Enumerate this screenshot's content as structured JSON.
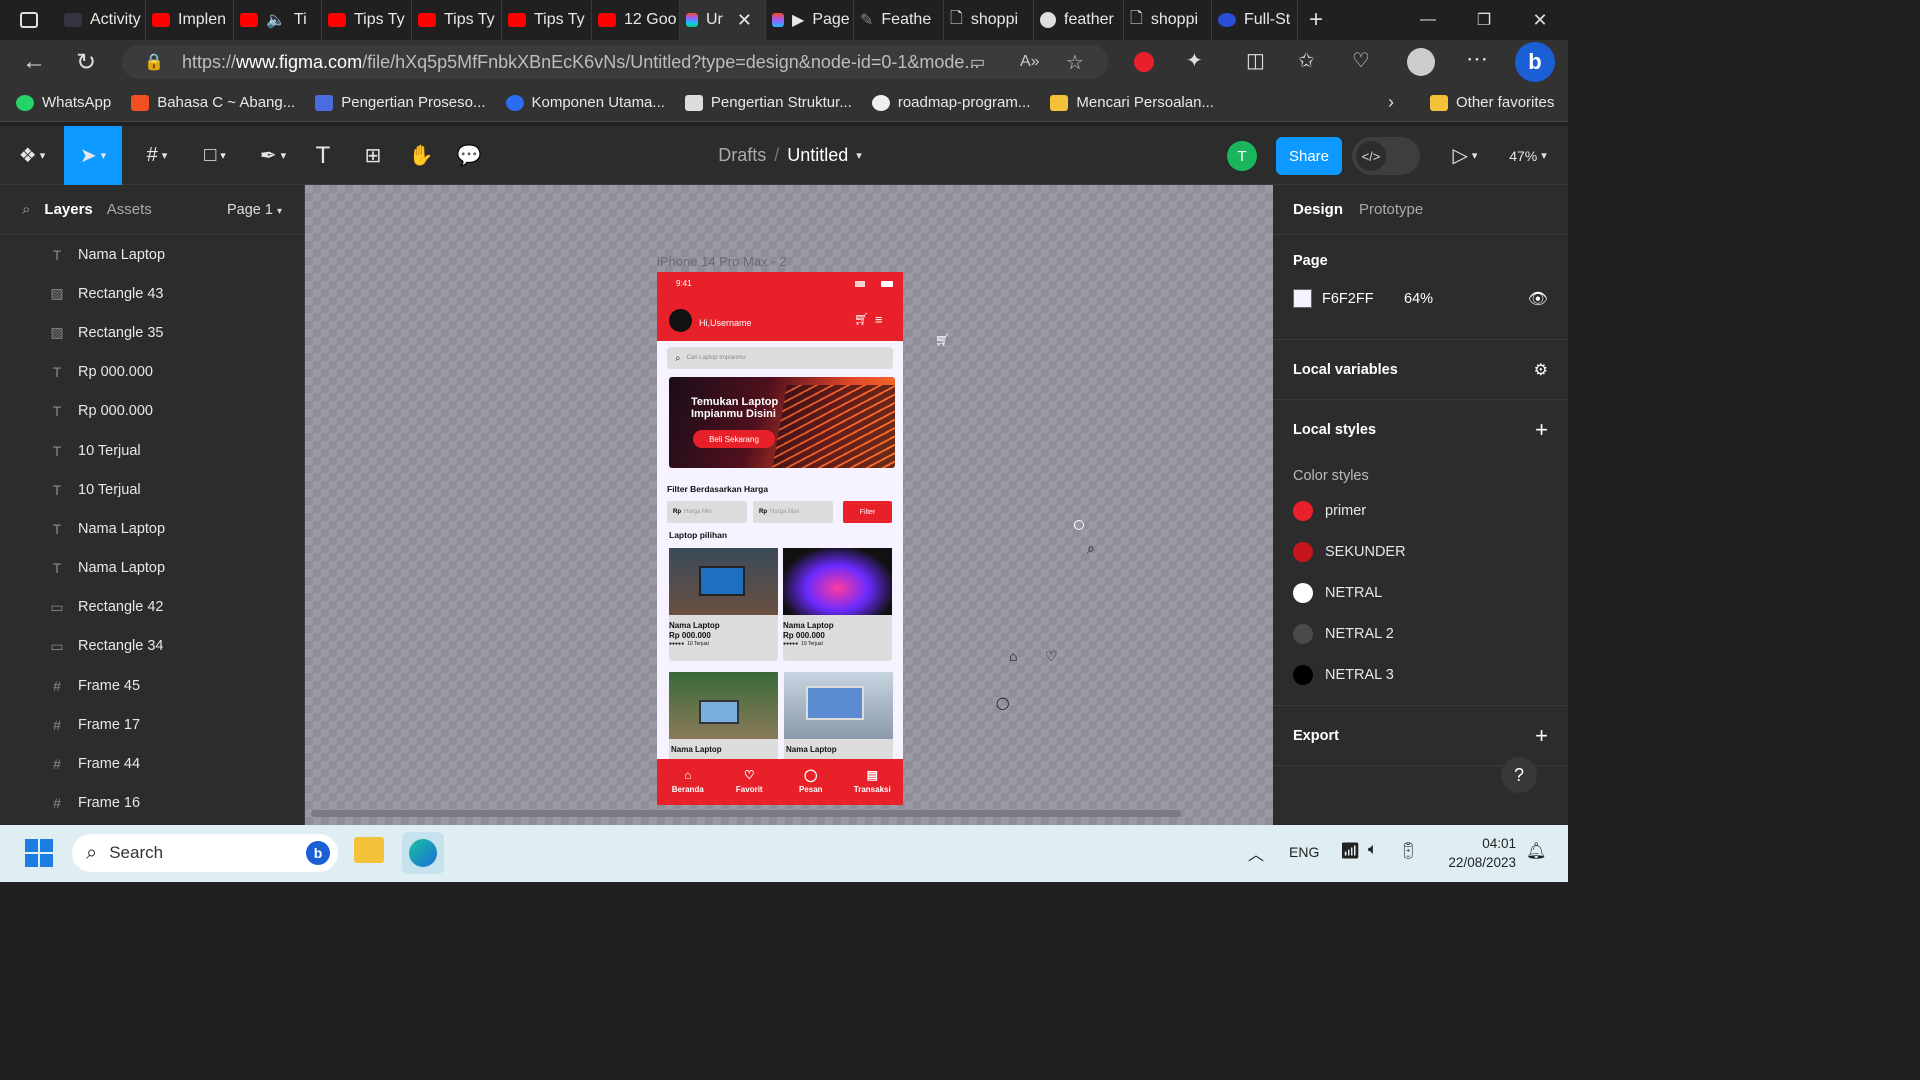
{
  "browser": {
    "tabs": [
      "Activity",
      "Implen",
      "Ti",
      "Tips Ty",
      "Tips Ty",
      "Tips Ty",
      "12 Goo",
      "Ur",
      "Page",
      "Feathe",
      "shoppi",
      "feather",
      "shoppi",
      "Full-St"
    ],
    "url_prefix": "https://",
    "url_domain": "www.figma.com",
    "url_rest": "/file/hXq5p5MfFnbkXBnEcK6vNs/Untitled?type=design&node-id=0-1&mode...",
    "bookmarks": [
      "WhatsApp",
      "Bahasa C ~ Abang...",
      "Pengertian Proseso...",
      "Komponen Utama...",
      "Pengertian Struktur...",
      "roadmap-program...",
      "Mencari Persoalan..."
    ],
    "other_favorites": "Other favorites"
  },
  "figma": {
    "breadcrumb_drafts": "Drafts",
    "breadcrumb_sep": "/",
    "file_name": "Untitled",
    "avatar_initial": "T",
    "share_label": "Share",
    "zoom": "47%",
    "left_tabs": {
      "layers": "Layers",
      "assets": "Assets",
      "page": "Page 1"
    },
    "layers": [
      {
        "name": "Nama Laptop",
        "icon": "text-icon"
      },
      {
        "name": "Rectangle 43",
        "icon": "image-icon"
      },
      {
        "name": "Rectangle 35",
        "icon": "image-icon"
      },
      {
        "name": "Rp 000.000",
        "icon": "text-icon"
      },
      {
        "name": "Rp 000.000",
        "icon": "text-icon"
      },
      {
        "name": "10 Terjual",
        "icon": "text-icon"
      },
      {
        "name": "10 Terjual",
        "icon": "text-icon"
      },
      {
        "name": "Nama Laptop",
        "icon": "text-icon"
      },
      {
        "name": "Nama Laptop",
        "icon": "text-icon"
      },
      {
        "name": "Rectangle 42",
        "icon": "rect-icon"
      },
      {
        "name": "Rectangle 34",
        "icon": "rect-icon"
      },
      {
        "name": "Frame 45",
        "icon": "frame-icon"
      },
      {
        "name": "Frame 17",
        "icon": "frame-icon"
      },
      {
        "name": "Frame 44",
        "icon": "frame-icon"
      },
      {
        "name": "Frame 16",
        "icon": "frame-icon"
      }
    ],
    "right_tabs": {
      "design": "Design",
      "prototype": "Prototype"
    },
    "page_section": "Page",
    "page_color": "F6F2FF",
    "page_opacity": "64%",
    "local_variables": "Local variables",
    "local_styles": "Local styles",
    "color_styles_title": "Color styles",
    "color_styles": [
      {
        "name": "primer",
        "color": "#e8202a"
      },
      {
        "name": "SEKUNDER",
        "color": "#c4161c"
      },
      {
        "name": "NETRAL",
        "color": "#ffffff"
      },
      {
        "name": "NETRAL 2",
        "color": "#4a4a4a"
      },
      {
        "name": "NETRAL 3",
        "color": "#000000"
      }
    ],
    "export": "Export",
    "help": "?"
  },
  "frame": {
    "label": "iPhone 14 Pro Max - 2",
    "time": "9:41",
    "greeting": "Hi,Username",
    "search_placeholder": "Cari Laptop Impianmu",
    "banner_title": "Temukan Laptop Impianmu Disini",
    "banner_button": "Beli Sekarang",
    "filter_title": "Filter Berdasarkan Harga",
    "rp": "Rp",
    "min_placeholder": "Harga Min",
    "max_placeholder": "Harga Max",
    "filter_button": "Filter",
    "section_title": "Laptop pilihan",
    "products": [
      {
        "name": "Nama Laptop",
        "price": "Rp 000.000",
        "sold": "10 Terjual"
      },
      {
        "name": "Nama Laptop",
        "price": "Rp 000.000",
        "sold": "10 Terjual"
      },
      {
        "name": "Nama Laptop"
      },
      {
        "name": "Nama Laptop"
      }
    ],
    "nav": [
      "Beranda",
      "Favorit",
      "Pesan",
      "Transaksi"
    ],
    "primary_color": "#e8202a"
  },
  "taskbar": {
    "search": "Search",
    "lang": "ENG",
    "time": "04:01",
    "date": "22/08/2023"
  }
}
